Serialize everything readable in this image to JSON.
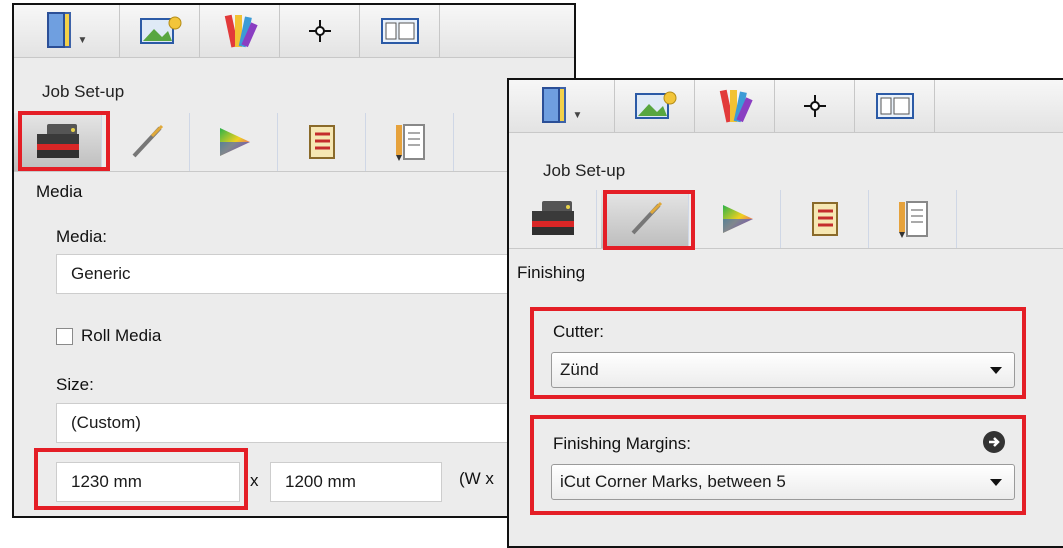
{
  "left_panel": {
    "group_title": "Job Set-up",
    "section": "Media",
    "media_label": "Media:",
    "media_value": "Generic",
    "roll_media_label": "Roll Media",
    "size_label": "Size:",
    "size_value": "(Custom)",
    "width_value": "1230 mm",
    "times": "x",
    "height_value": "1200 mm",
    "dims_hint": "(W x"
  },
  "right_panel": {
    "group_title": "Job Set-up",
    "section": "Finishing",
    "cutter_label": "Cutter:",
    "cutter_value": "Zünd",
    "margins_label": "Finishing Margins:",
    "margins_value": "iCut Corner Marks, between 5"
  },
  "colors": {
    "highlight": "#e41e26",
    "panel_bg": "#ececec"
  },
  "icons": {
    "toolbar": [
      "job-book-icon",
      "image-edit-icon",
      "color-swatch-icon",
      "crosshair-icon",
      "layout-icon"
    ],
    "tabs": [
      "printer-media-icon",
      "cutter-blade-icon",
      "color-triangle-icon",
      "checklist-icon",
      "job-ticket-icon"
    ]
  }
}
